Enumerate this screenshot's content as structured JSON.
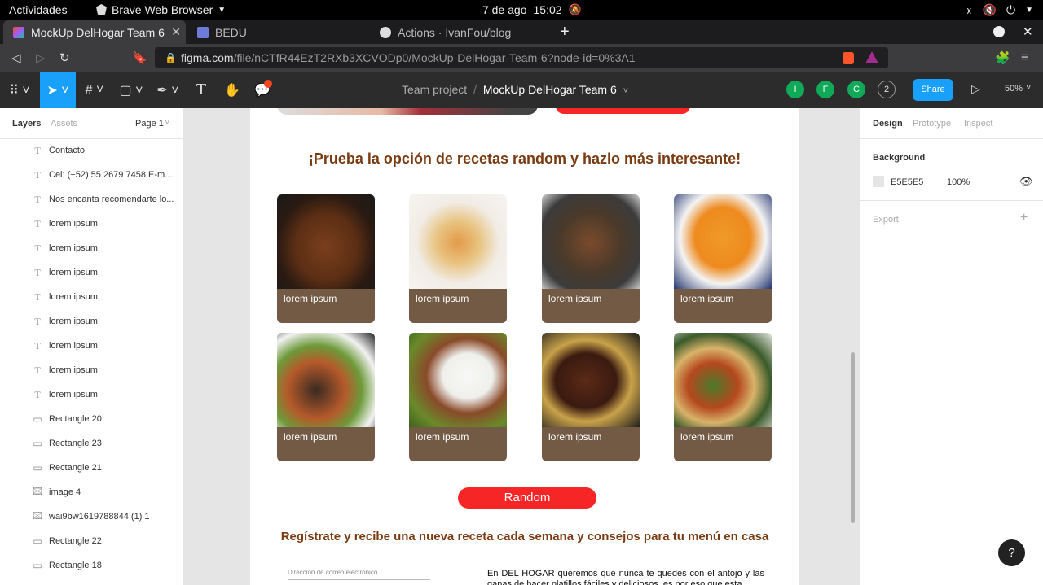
{
  "os_bar": {
    "activities": "Actividades",
    "app_name": "Brave Web Browser",
    "date": "7 de ago",
    "time": "15:02"
  },
  "browser": {
    "tabs": [
      {
        "label": "MockUp DelHogar Team 6"
      },
      {
        "label": "BEDU"
      },
      {
        "label": "Actions · IvanFou/blog"
      }
    ],
    "url_host": "figma.com",
    "url_path": "/file/nCTfR44EzT2RXb3XCVODp0/MockUp-DelHogar-Team-6?node-id=0%3A1"
  },
  "figma": {
    "breadcrumb_team": "Team project",
    "file_name": "MockUp DelHogar Team 6",
    "avatars": [
      "I",
      "F",
      "C"
    ],
    "avatar_more": "2",
    "share_label": "Share",
    "zoom": "50%"
  },
  "layers_panel": {
    "tab_layers": "Layers",
    "tab_assets": "Assets",
    "page": "Page 1",
    "items": [
      {
        "type": "text",
        "name": "Contacto"
      },
      {
        "type": "text",
        "name": "Cel: (+52) 55 2679 7458 E-m..."
      },
      {
        "type": "text",
        "name": "Nos encanta recomendarte lo..."
      },
      {
        "type": "text",
        "name": "lorem ipsum"
      },
      {
        "type": "text",
        "name": "lorem ipsum"
      },
      {
        "type": "text",
        "name": "lorem ipsum"
      },
      {
        "type": "text",
        "name": "lorem ipsum"
      },
      {
        "type": "text",
        "name": "lorem ipsum"
      },
      {
        "type": "text",
        "name": "lorem ipsum"
      },
      {
        "type": "text",
        "name": "lorem ipsum"
      },
      {
        "type": "text",
        "name": "lorem ipsum"
      },
      {
        "type": "rect",
        "name": "Rectangle 20"
      },
      {
        "type": "rect",
        "name": "Rectangle 23"
      },
      {
        "type": "rect",
        "name": "Rectangle 21"
      },
      {
        "type": "image",
        "name": "image 4"
      },
      {
        "type": "image",
        "name": "wai9bw1619788844 (1) 1"
      },
      {
        "type": "rect",
        "name": "Rectangle 22"
      },
      {
        "type": "rect",
        "name": "Rectangle 18"
      }
    ]
  },
  "design_panel": {
    "tab_design": "Design",
    "tab_prototype": "Prototype",
    "tab_inspect": "Inspect",
    "background_label": "Background",
    "background_hex": "E5E5E5",
    "background_opacity": "100%",
    "export_label": "Export"
  },
  "canvas": {
    "heading": "¡Prueba la opción de recetas random y hazlo más interesante!",
    "cards": [
      {
        "label": "lorem ipsum",
        "food": "pie"
      },
      {
        "label": "lorem ipsum",
        "food": "pudding"
      },
      {
        "label": "lorem ipsum",
        "food": "stew"
      },
      {
        "label": "lorem ipsum",
        "food": "soup"
      },
      {
        "label": "lorem ipsum",
        "food": "steak"
      },
      {
        "label": "lorem ipsum",
        "food": "rice"
      },
      {
        "label": "lorem ipsum",
        "food": "grill"
      },
      {
        "label": "lorem ipsum",
        "food": "salad"
      }
    ],
    "random_label": "Random",
    "signup_heading": "Regístrate y recibe una nueva receta cada semana y consejos para tu menú en casa",
    "email_placeholder": "Dirección de correo electrónico",
    "about_text": "En DEL HOGAR queremos que nunca te quedes con el antojo y las ganas de hacer platillos fáciles y deliciosos, es por eso que esta"
  },
  "colors": {
    "accent": "#18a0fb",
    "card_caption": "#735a44",
    "random_button": "#f62626",
    "heading_brown": "#7a3b12"
  }
}
